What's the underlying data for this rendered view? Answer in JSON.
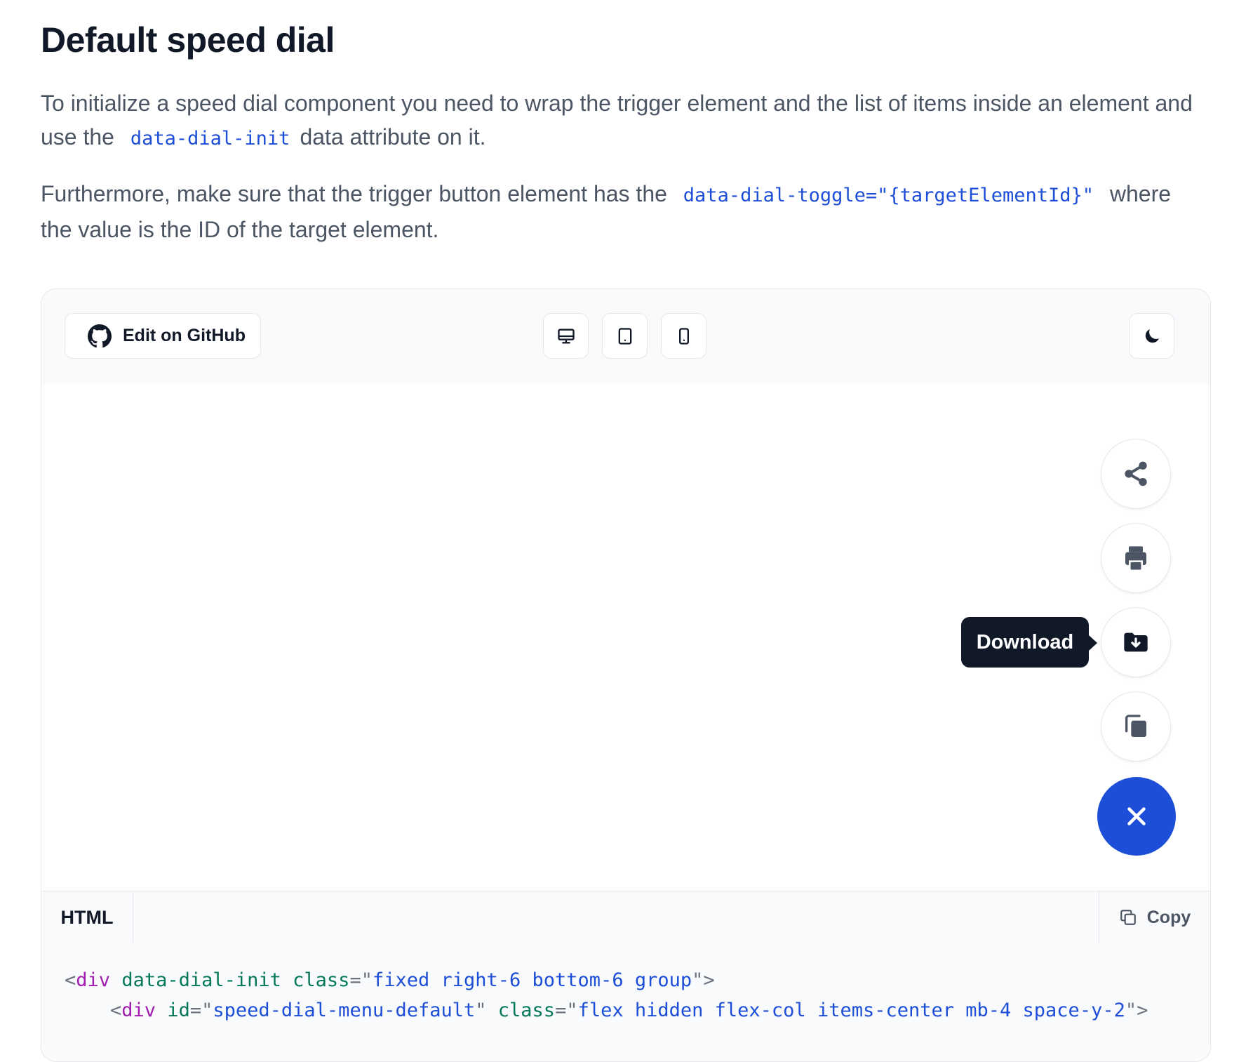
{
  "heading": "Default speed dial",
  "intro": {
    "p1_before": "To initialize a speed dial component you need to wrap the trigger element and the list of items inside an element and use the",
    "p1_code": "data-dial-init",
    "p1_after": "data attribute on it.",
    "p2_before": "Furthermore, make sure that the trigger button element has the",
    "p2_code": "data-dial-toggle=\"{targetElementId}\"",
    "p2_after": "where the value is the ID of the target element."
  },
  "toolbar": {
    "github_label": "Edit on GitHub",
    "icons": [
      "github-icon",
      "desktop-icon",
      "tablet-icon",
      "mobile-icon",
      "moon-icon"
    ]
  },
  "speed_dial": {
    "items": [
      "share-icon",
      "print-icon",
      "download-icon",
      "copy-icon"
    ],
    "tooltip": "Download",
    "trigger_icon": "close-icon",
    "accent_color": "#1d4ed8"
  },
  "code": {
    "tab_label": "HTML",
    "copy_label": "Copy",
    "line1": {
      "tag": "div",
      "attr1": "data-dial-init",
      "attr2": "class",
      "value2": "fixed right-6 bottom-6 group"
    },
    "line2": {
      "tag": "div",
      "attr1": "id",
      "value1": "speed-dial-menu-default",
      "attr2": "class",
      "value2": "flex hidden flex-col items-center mb-4 space-y-2"
    }
  }
}
